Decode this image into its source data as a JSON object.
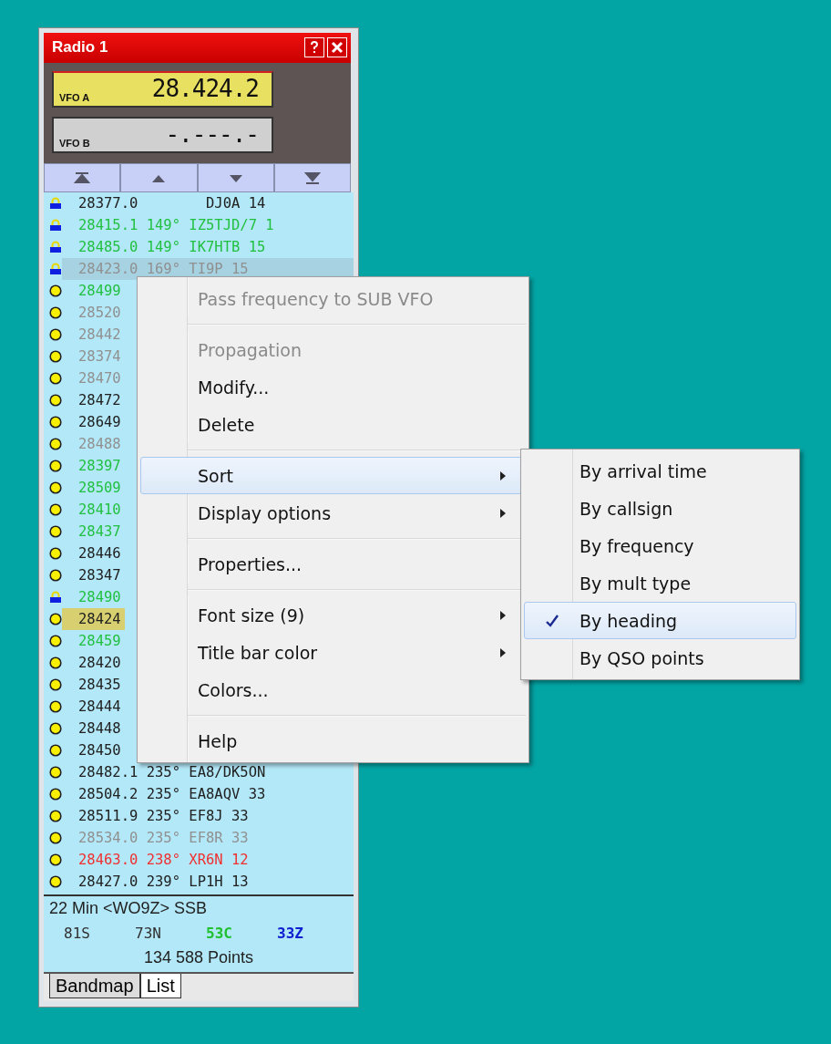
{
  "window": {
    "title": "Radio 1"
  },
  "vfos": [
    {
      "label": "VFO A",
      "value": "28.424.2",
      "active": true
    },
    {
      "label": "VFO B",
      "value": "-.---.-",
      "active": false
    }
  ],
  "nav_buttons": [
    {
      "kind": "first"
    },
    {
      "kind": "up"
    },
    {
      "kind": "down"
    },
    {
      "kind": "last"
    }
  ],
  "spots": [
    {
      "kind": "lock",
      "text": "28377.0        DJ0A 14",
      "color": "#202020",
      "selected": false,
      "current": false
    },
    {
      "kind": "lock",
      "text": "28415.1 149° IZ5TJD/7 1",
      "color": "#22c040",
      "selected": false,
      "current": false
    },
    {
      "kind": "lock",
      "text": "28485.0 149° IK7HTB 15",
      "color": "#22c040",
      "selected": false,
      "current": false
    },
    {
      "kind": "lock",
      "text": "28423.0 169° TI9P 15",
      "color": "#909090",
      "selected": true,
      "current": false
    },
    {
      "kind": "dot",
      "text": "28499",
      "color": "#22c040",
      "selected": false,
      "current": false
    },
    {
      "kind": "dot",
      "text": "28520",
      "color": "#909090",
      "selected": false,
      "current": false
    },
    {
      "kind": "dot",
      "text": "28442",
      "color": "#909090",
      "selected": false,
      "current": false
    },
    {
      "kind": "dot",
      "text": "28374",
      "color": "#909090",
      "selected": false,
      "current": false
    },
    {
      "kind": "dot",
      "text": "28470",
      "color": "#909090",
      "selected": false,
      "current": false
    },
    {
      "kind": "dot",
      "text": "28472",
      "color": "#202020",
      "selected": false,
      "current": false
    },
    {
      "kind": "dot",
      "text": "28649",
      "color": "#202020",
      "selected": false,
      "current": false
    },
    {
      "kind": "dot",
      "text": "28488",
      "color": "#909090",
      "selected": false,
      "current": false
    },
    {
      "kind": "dot",
      "text": "28397",
      "color": "#22c040",
      "selected": false,
      "current": false
    },
    {
      "kind": "dot",
      "text": "28509",
      "color": "#22c040",
      "selected": false,
      "current": false
    },
    {
      "kind": "dot",
      "text": "28410",
      "color": "#22c040",
      "selected": false,
      "current": false
    },
    {
      "kind": "dot",
      "text": "28437",
      "color": "#22c040",
      "selected": false,
      "current": false
    },
    {
      "kind": "dot",
      "text": "28446",
      "color": "#202020",
      "selected": false,
      "current": false
    },
    {
      "kind": "dot",
      "text": "28347",
      "color": "#202020",
      "selected": false,
      "current": false
    },
    {
      "kind": "lock",
      "text": "28490",
      "color": "#22c040",
      "selected": false,
      "current": false
    },
    {
      "kind": "dot",
      "text": "28424",
      "color": "#202020",
      "selected": false,
      "current": true
    },
    {
      "kind": "dot",
      "text": "28459",
      "color": "#22c040",
      "selected": false,
      "current": false
    },
    {
      "kind": "dot",
      "text": "28420",
      "color": "#202020",
      "selected": false,
      "current": false
    },
    {
      "kind": "dot",
      "text": "28435",
      "color": "#202020",
      "selected": false,
      "current": false
    },
    {
      "kind": "dot",
      "text": "28444",
      "color": "#202020",
      "selected": false,
      "current": false
    },
    {
      "kind": "dot",
      "text": "28448",
      "color": "#202020",
      "selected": false,
      "current": false
    },
    {
      "kind": "dot",
      "text": "28450",
      "color": "#202020",
      "selected": false,
      "current": false
    },
    {
      "kind": "dot",
      "text": "28482.1 235° EA8/DK5ON",
      "color": "#202020",
      "selected": false,
      "current": false
    },
    {
      "kind": "dot",
      "text": "28504.2 235° EA8AQV 33",
      "color": "#202020",
      "selected": false,
      "current": false
    },
    {
      "kind": "dot",
      "text": "28511.9 235° EF8J 33",
      "color": "#202020",
      "selected": false,
      "current": false
    },
    {
      "kind": "dot",
      "text": "28534.0 235° EF8R 33",
      "color": "#909090",
      "selected": false,
      "current": false
    },
    {
      "kind": "dot",
      "text": "28463.0 238° XR6N 12",
      "color": "#f03030",
      "selected": false,
      "current": false
    },
    {
      "kind": "dot",
      "text": "28427.0 239° LP1H 13",
      "color": "#202020",
      "selected": false,
      "current": false
    }
  ],
  "status": {
    "text": "22 Min <WO9Z> SSB",
    "counts": [
      {
        "text": "81S",
        "color": "#303030"
      },
      {
        "text": "73N",
        "color": "#303030"
      },
      {
        "text": "53C",
        "color": "#20c030"
      },
      {
        "text": "33Z",
        "color": "#1020d0"
      }
    ],
    "points": "134 588 Points"
  },
  "tabs": [
    {
      "label": "Bandmap",
      "selected": false
    },
    {
      "label": "List",
      "selected": true
    }
  ],
  "context_menu": [
    {
      "kind": "item",
      "label": "Pass frequency to SUB VFO",
      "disabled": true,
      "submenu": false,
      "selected": false
    },
    {
      "kind": "separator"
    },
    {
      "kind": "item",
      "label": "Propagation",
      "disabled": true,
      "submenu": false,
      "selected": false
    },
    {
      "kind": "item",
      "label": "Modify...",
      "disabled": false,
      "submenu": false,
      "selected": false
    },
    {
      "kind": "item",
      "label": "Delete",
      "disabled": false,
      "submenu": false,
      "selected": false
    },
    {
      "kind": "separator"
    },
    {
      "kind": "item",
      "label": "Sort",
      "disabled": false,
      "submenu": true,
      "selected": true
    },
    {
      "kind": "item",
      "label": "Display options",
      "disabled": false,
      "submenu": true,
      "selected": false
    },
    {
      "kind": "separator"
    },
    {
      "kind": "item",
      "label": "Properties...",
      "disabled": false,
      "submenu": false,
      "selected": false
    },
    {
      "kind": "separator"
    },
    {
      "kind": "item",
      "label": "Font size (9)",
      "disabled": false,
      "submenu": true,
      "selected": false
    },
    {
      "kind": "item",
      "label": "Title bar color",
      "disabled": false,
      "submenu": true,
      "selected": false
    },
    {
      "kind": "item",
      "label": "Colors...",
      "disabled": false,
      "submenu": false,
      "selected": false
    },
    {
      "kind": "separator"
    },
    {
      "kind": "item",
      "label": "Help",
      "disabled": false,
      "submenu": false,
      "selected": false
    }
  ],
  "sort_submenu": [
    {
      "label": "By arrival time",
      "checked": false,
      "selected": false
    },
    {
      "label": "By callsign",
      "checked": false,
      "selected": false
    },
    {
      "label": "By frequency",
      "checked": false,
      "selected": false
    },
    {
      "label": "By mult type",
      "checked": false,
      "selected": false
    },
    {
      "label": "By heading",
      "checked": true,
      "selected": true
    },
    {
      "label": "By QSO points",
      "checked": false,
      "selected": false
    }
  ]
}
